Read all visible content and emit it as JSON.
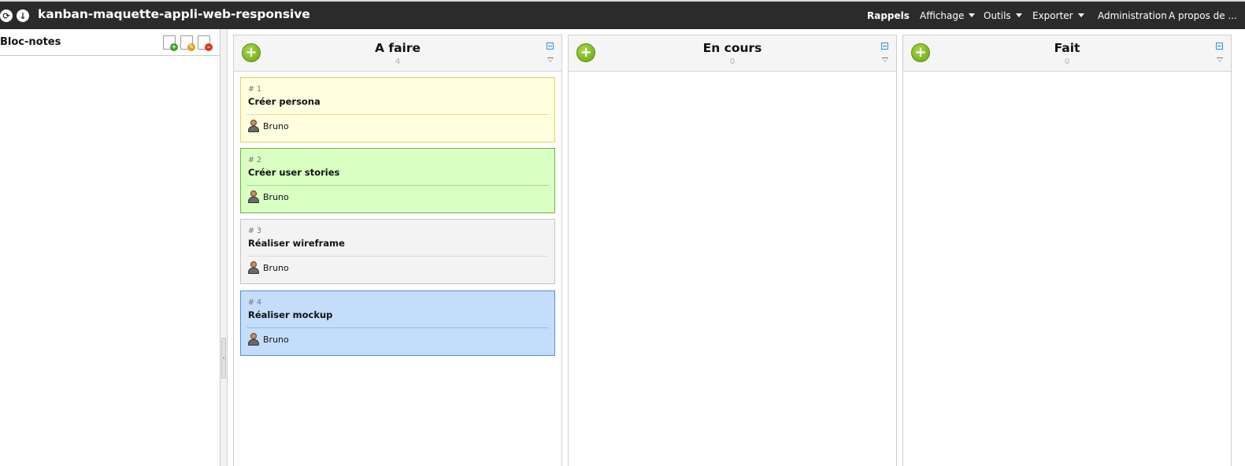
{
  "topbar": {
    "title": "kanban-maquette-appli-web-responsive",
    "menu": [
      {
        "label": "Rappels",
        "dropdown": false,
        "bold": true
      },
      {
        "label": "Affichage",
        "dropdown": true,
        "bold": false
      },
      {
        "label": "Outils",
        "dropdown": true,
        "bold": false
      },
      {
        "label": "Exporter",
        "dropdown": true,
        "bold": false
      },
      {
        "label": "Administration",
        "dropdown": false,
        "bold": false
      },
      {
        "label": "A propos de ...",
        "dropdown": false,
        "bold": false
      }
    ],
    "icons": [
      "refresh-icon",
      "download-icon"
    ]
  },
  "sidebar": {
    "title": "Bloc-notes",
    "tools": [
      "new-note-icon",
      "edit-note-icon",
      "delete-note-icon"
    ]
  },
  "columns": [
    {
      "title": "A faire",
      "count": "4",
      "cards": [
        {
          "number": "# 1",
          "title": "Créer persona",
          "user": "Bruno",
          "bg": "#ffffdf",
          "border": "#e8cf5c",
          "sep": "#ecdca1"
        },
        {
          "number": "# 2",
          "title": "Créer user stories",
          "user": "Bruno",
          "bg": "#d9ffc2",
          "border": "#6bb43b",
          "sep": "#a8dc88"
        },
        {
          "number": "# 3",
          "title": "Réaliser wireframe",
          "user": "Bruno",
          "bg": "#f3f3f3",
          "border": "#c4c4c4",
          "sep": "#dddddd"
        },
        {
          "number": "# 4",
          "title": "Réaliser mockup",
          "user": "Bruno",
          "bg": "#c4ddfb",
          "border": "#4f8fd8",
          "sep": "#94bde9"
        }
      ]
    },
    {
      "title": "En cours",
      "count": "0",
      "cards": []
    },
    {
      "title": "Fait",
      "count": "0",
      "cards": []
    }
  ]
}
